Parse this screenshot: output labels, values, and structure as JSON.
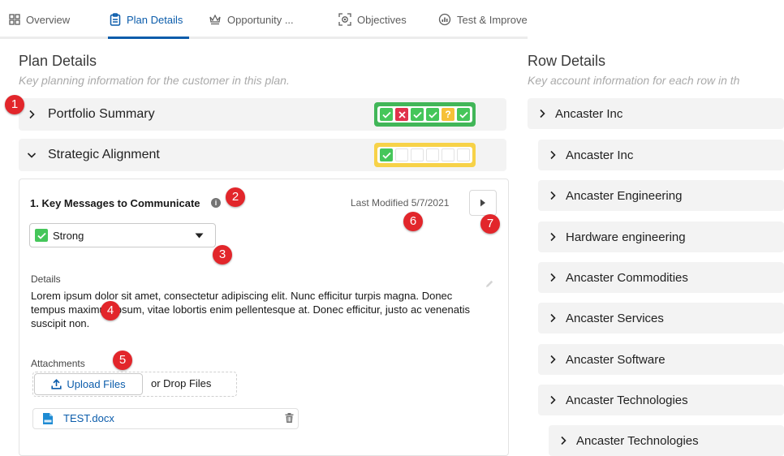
{
  "tabs": [
    {
      "label": "Overview",
      "icon": "grid-icon"
    },
    {
      "label": "Plan Details",
      "icon": "clipboard-icon",
      "active": true
    },
    {
      "label": "Opportunity ...",
      "icon": "crown-icon"
    },
    {
      "label": "Objectives",
      "icon": "target-icon"
    },
    {
      "label": "Test & Improve",
      "icon": "gauge-icon"
    }
  ],
  "plan": {
    "title": "Plan Details",
    "subtitle": "Key planning information for the customer in this plan.",
    "portfolio": {
      "label": "Portfolio Summary",
      "status_color": "#41b658",
      "cells": [
        "ok",
        "bad",
        "ok",
        "ok",
        "q",
        "ok"
      ]
    },
    "strategic": {
      "label": "Strategic Alignment",
      "status_color": "#f7d248",
      "cells": [
        "ok",
        "empty",
        "empty",
        "empty",
        "empty",
        "empty"
      ]
    },
    "key_messages": {
      "title": "1. Key Messages to Communicate",
      "info": "i",
      "last_modified": "Last Modified 5/7/2021",
      "rating": "Strong",
      "details_label": "Details",
      "details_text": "Lorem ipsum dolor sit amet, consectetur adipiscing elit. Nunc efficitur turpis magna. Donec tempus maximus ipsum, vitae lobortis enim pellentesque at. Donec efficitur, justo ac venenatis suscipit non.",
      "attachments_label": "Attachments",
      "upload_label": "Upload Files",
      "drop_label": "or Drop Files",
      "file_name": "TEST.docx"
    }
  },
  "badges": [
    "1",
    "2",
    "3",
    "4",
    "5",
    "6",
    "7"
  ],
  "row_details": {
    "title": "Row Details",
    "subtitle": "Key account information for each row in th",
    "rows": [
      "Ancaster Inc",
      "Ancaster Inc",
      "Ancaster Engineering",
      "Hardware engineering",
      "Ancaster Commodities",
      "Ancaster Services",
      "Ancaster Software",
      "Ancaster Technologies",
      "Ancaster Technologies"
    ]
  },
  "colors": {
    "accent": "#0b5cab",
    "badge": "#e2262b",
    "ok": "#45c65a",
    "bad": "#e0314b",
    "warn": "#f6c138"
  }
}
